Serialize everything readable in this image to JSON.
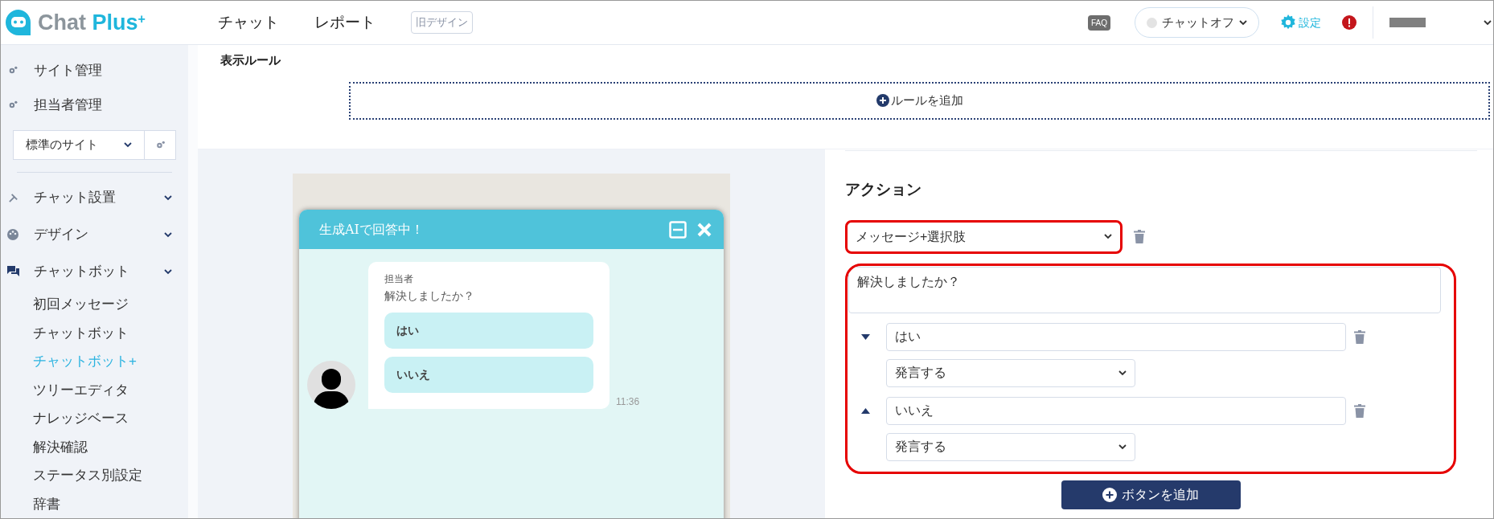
{
  "header": {
    "logo": {
      "word1": "Chat",
      "word2": "Plus",
      "mark": "+"
    },
    "nav": [
      {
        "label": "チャット"
      },
      {
        "label": "レポート"
      }
    ],
    "old_design_button": "旧デザイン",
    "faq": "FAQ",
    "status": {
      "label": "チャットオフ",
      "online": false
    },
    "settings": "設定"
  },
  "sidebar": {
    "top_items": [
      {
        "label": "サイト管理"
      },
      {
        "label": "担当者管理"
      }
    ],
    "site_select": "標準のサイト",
    "sections": [
      {
        "label": "チャット設置"
      },
      {
        "label": "デザイン"
      },
      {
        "label": "チャットボット",
        "children": [
          {
            "label": "初回メッセージ",
            "selected": false
          },
          {
            "label": "チャットボット",
            "selected": false
          },
          {
            "label": "チャットボット+",
            "selected": true
          },
          {
            "label": "ツリーエディタ",
            "selected": false
          },
          {
            "label": "ナレッジベース",
            "selected": false
          },
          {
            "label": "解決確認",
            "selected": false
          },
          {
            "label": "ステータス別設定",
            "selected": false
          },
          {
            "label": "辞書",
            "selected": false
          }
        ]
      }
    ]
  },
  "display_rule": {
    "title": "表示ルール",
    "add_button": "ルールを追加"
  },
  "preview": {
    "title": "生成AIで回答中！",
    "agent": "担当者",
    "message": "解決しましたか？",
    "options": [
      "はい",
      "いいえ"
    ],
    "time": "11:36"
  },
  "action": {
    "title": "アクション",
    "type_select": "メッセージ+選択肢",
    "message": "解決しましたか？",
    "choices": [
      {
        "label": "はい",
        "action": "発言する",
        "kind": "movedown"
      },
      {
        "label": "いいえ",
        "action": "発言する",
        "kind": "moveup"
      }
    ],
    "add_button": "ボタンを追加"
  }
}
